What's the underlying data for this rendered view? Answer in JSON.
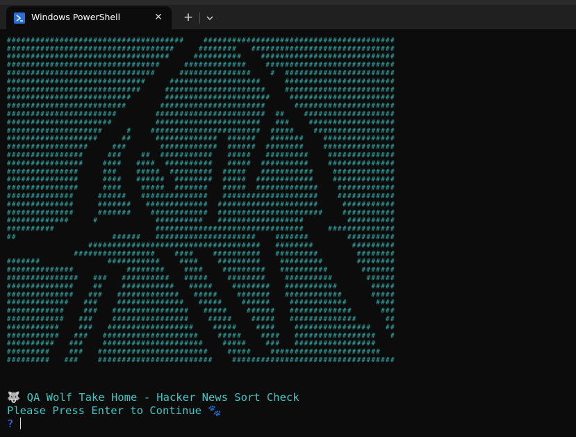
{
  "tab": {
    "title": "Windows PowerShell",
    "close_glyph": "✕",
    "new_tab_glyph": "+",
    "icon": "powershell-icon"
  },
  "terminal": {
    "art_glyph": "#",
    "art_color": "#3cc7c4",
    "lines": {
      "title_emoji": "🐺",
      "title_text": "QA Wolf Take Home - Hacker News Sort Check",
      "prompt_text": "Please Press Enter to Continue",
      "prompt_emoji": "🐾",
      "question_mark": "?"
    }
  },
  "colors": {
    "background": "#0c0c0c",
    "tabbar": "#202020",
    "accent_text": "#3cc7c4",
    "prompt_blue": "#3b78ff"
  }
}
